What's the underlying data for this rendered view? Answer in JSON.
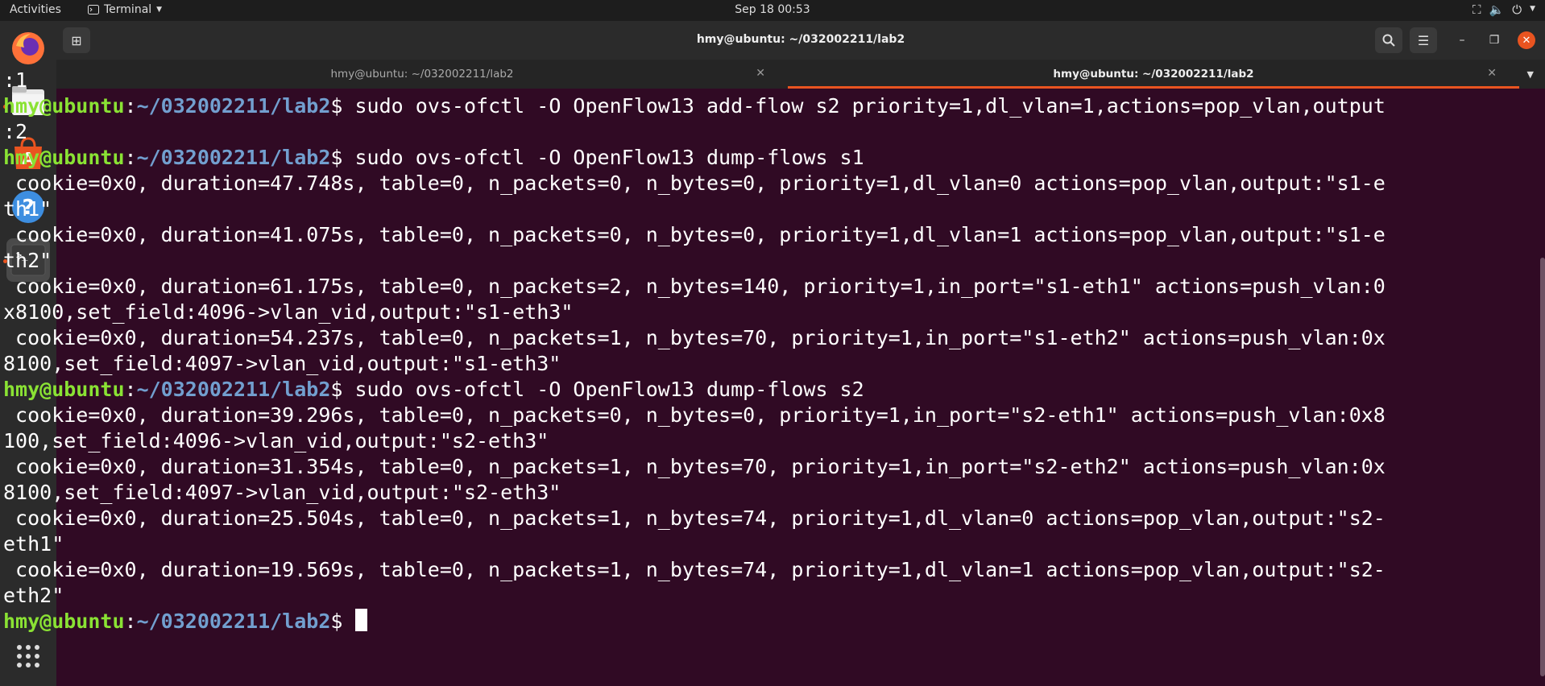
{
  "topbar": {
    "activities": "Activities",
    "app_name": "Terminal",
    "clock": "Sep 18  00:53"
  },
  "dock": {
    "items": [
      "firefox-icon",
      "files-icon",
      "software-icon",
      "help-icon",
      "terminal-icon"
    ],
    "apps_grid": "apps-grid-icon"
  },
  "window": {
    "title": "hmy@ubuntu: ~/032002211/lab2",
    "tabs": [
      {
        "label": "hmy@ubuntu: ~/032002211/lab2"
      },
      {
        "label": "hmy@ubuntu: ~/032002211/lab2"
      }
    ]
  },
  "terminal": {
    "lines": [
      ":1",
      "hmy@ubuntu:~/032002211/lab2$ sudo ovs-ofctl -O OpenFlow13 add-flow s2 priority=1,dl_vlan=1,actions=pop_vlan,output",
      ":2",
      "hmy@ubuntu:~/032002211/lab2$ sudo ovs-ofctl -O OpenFlow13 dump-flows s1",
      " cookie=0x0, duration=47.748s, table=0, n_packets=0, n_bytes=0, priority=1,dl_vlan=0 actions=pop_vlan,output:\"s1-e",
      "th1\"",
      " cookie=0x0, duration=41.075s, table=0, n_packets=0, n_bytes=0, priority=1,dl_vlan=1 actions=pop_vlan,output:\"s1-e",
      "th2\"",
      " cookie=0x0, duration=61.175s, table=0, n_packets=2, n_bytes=140, priority=1,in_port=\"s1-eth1\" actions=push_vlan:0",
      "x8100,set_field:4096->vlan_vid,output:\"s1-eth3\"",
      " cookie=0x0, duration=54.237s, table=0, n_packets=1, n_bytes=70, priority=1,in_port=\"s1-eth2\" actions=push_vlan:0x",
      "8100,set_field:4097->vlan_vid,output:\"s1-eth3\"",
      "hmy@ubuntu:~/032002211/lab2$ sudo ovs-ofctl -O OpenFlow13 dump-flows s2",
      " cookie=0x0, duration=39.296s, table=0, n_packets=0, n_bytes=0, priority=1,in_port=\"s2-eth1\" actions=push_vlan:0x8",
      "100,set_field:4096->vlan_vid,output:\"s2-eth3\"",
      " cookie=0x0, duration=31.354s, table=0, n_packets=1, n_bytes=70, priority=1,in_port=\"s2-eth2\" actions=push_vlan:0x",
      "8100,set_field:4097->vlan_vid,output:\"s2-eth3\"",
      " cookie=0x0, duration=25.504s, table=0, n_packets=1, n_bytes=74, priority=1,dl_vlan=0 actions=pop_vlan,output:\"s2-",
      "eth1\"",
      " cookie=0x0, duration=19.569s, table=0, n_packets=1, n_bytes=74, priority=1,dl_vlan=1 actions=pop_vlan,output:\"s2-",
      "eth2\"",
      "hmy@ubuntu:~/032002211/lab2$ "
    ],
    "prompt_user": "hmy@ubuntu",
    "prompt_path": "~/032002211/lab2"
  }
}
